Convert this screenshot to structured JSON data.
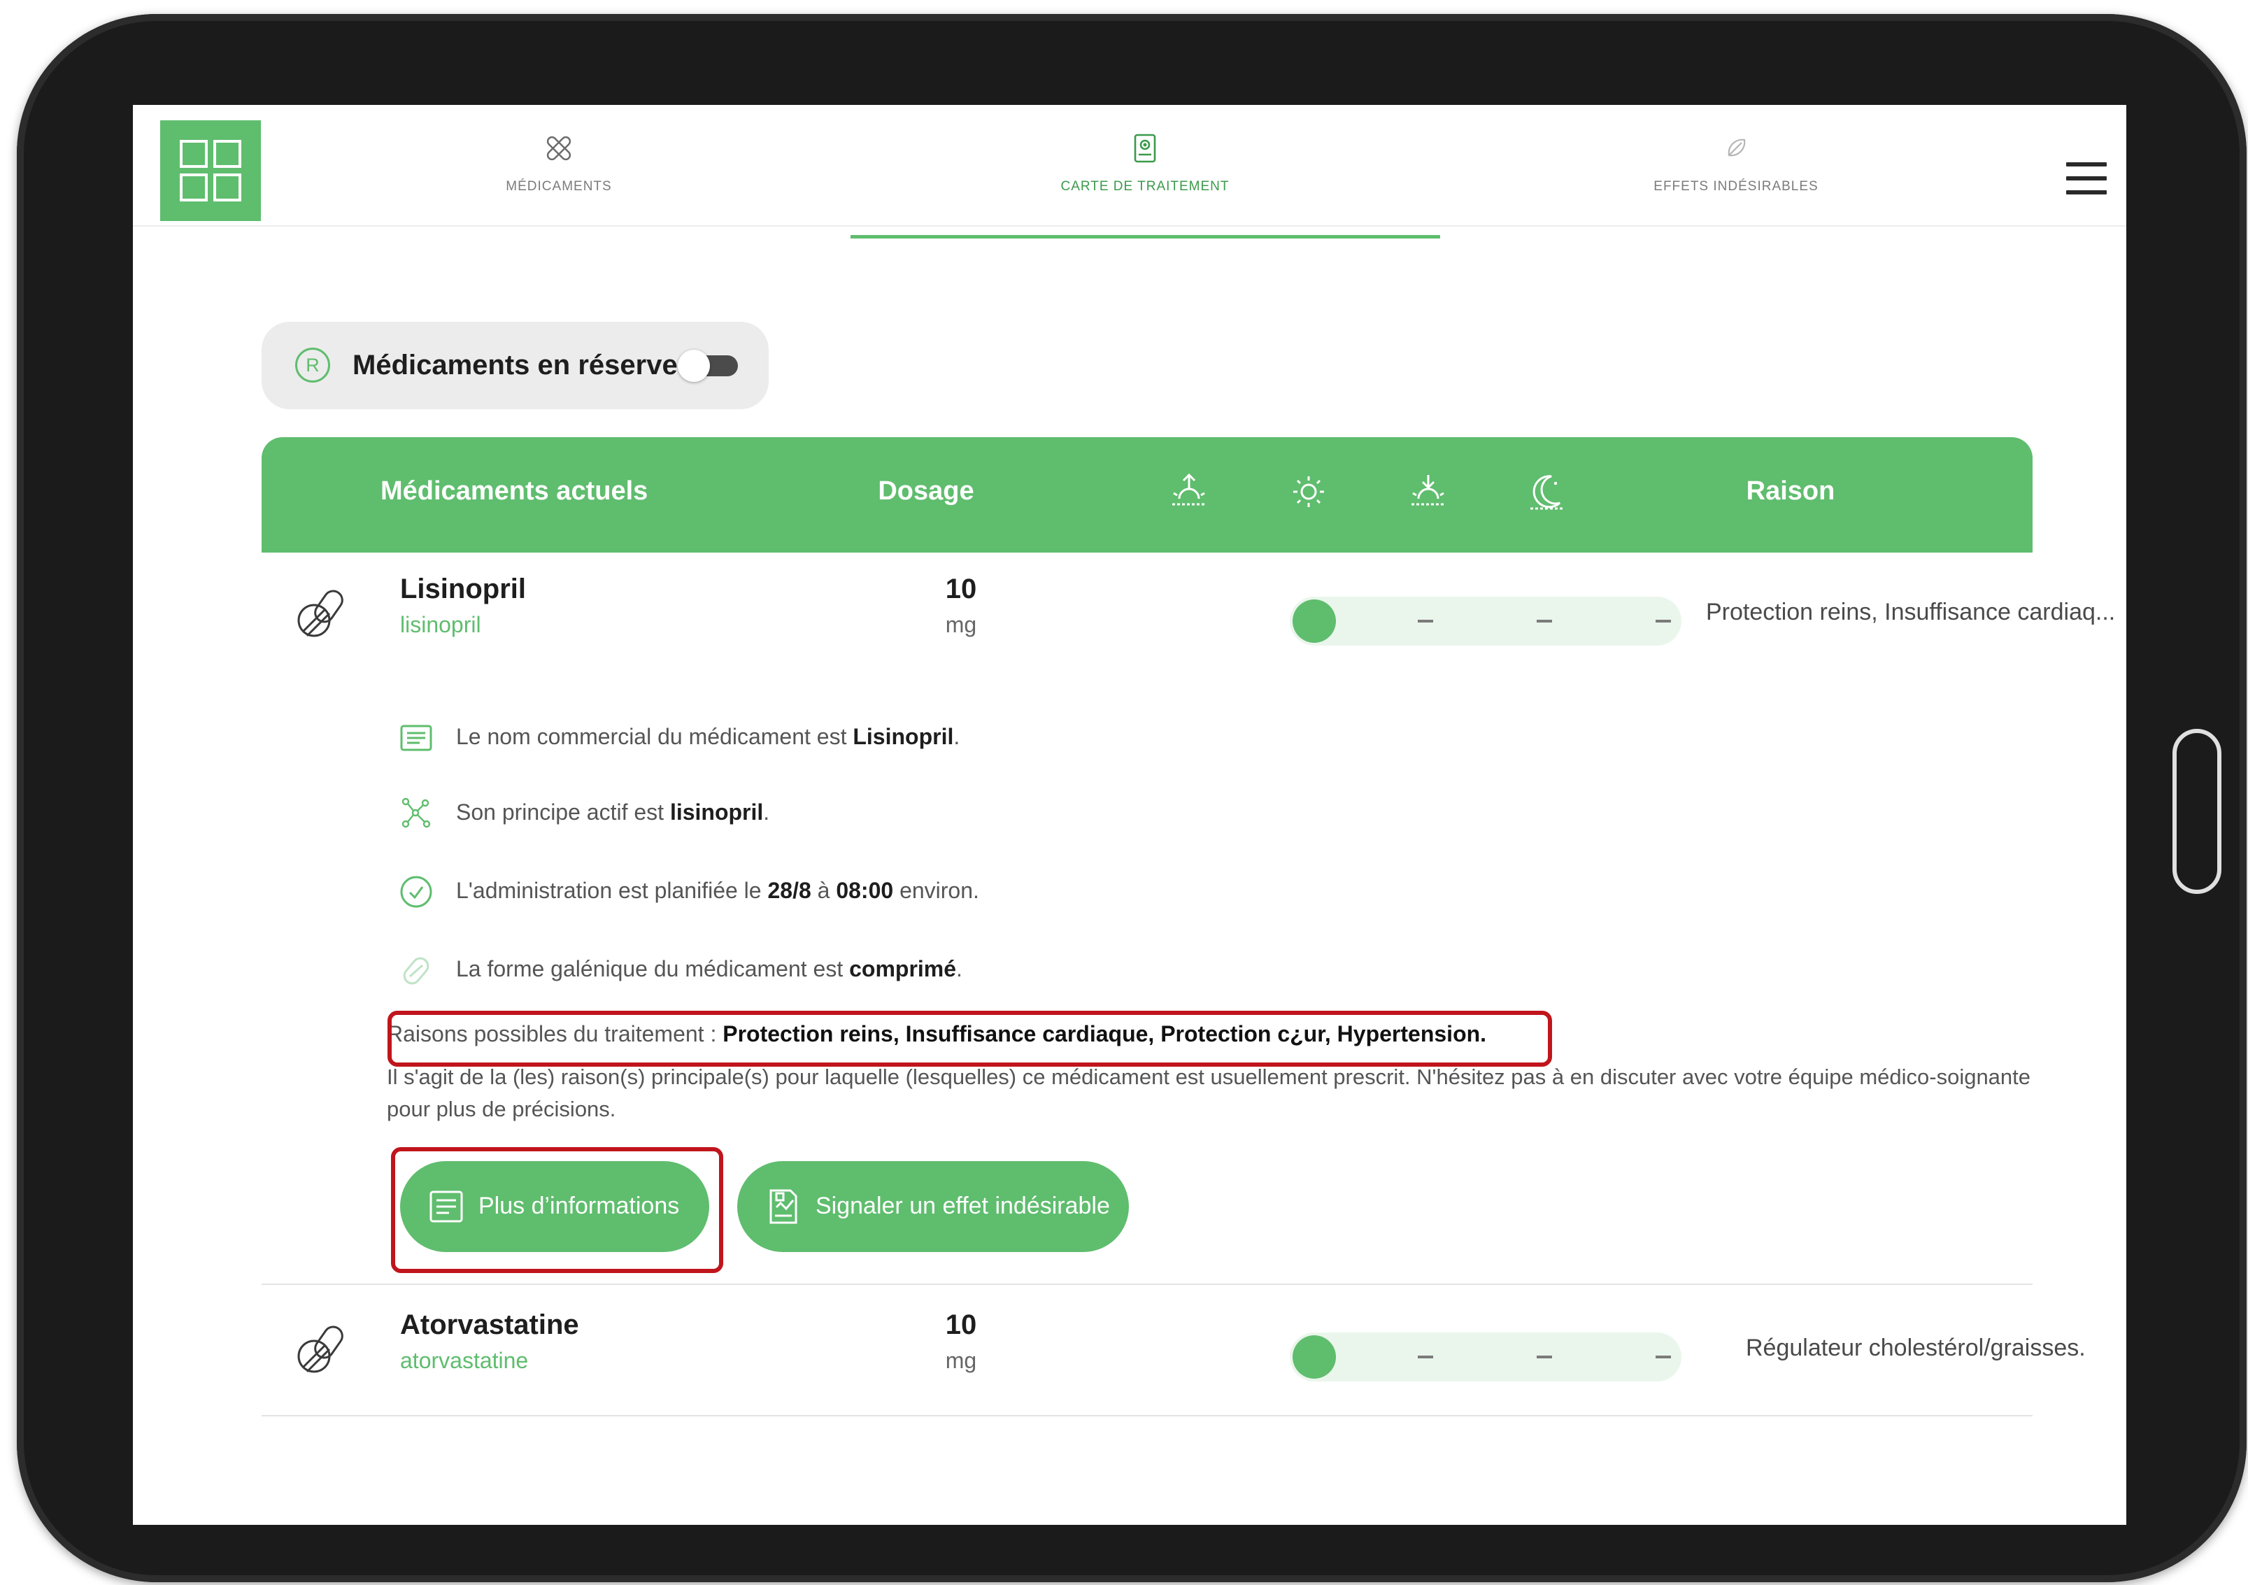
{
  "nav": {
    "tabs": [
      {
        "label": "MÉDICAMENTS",
        "icon": "bandage-icon"
      },
      {
        "label": "CARTE DE TRAITEMENT",
        "icon": "treatment-card-icon"
      },
      {
        "label": "EFFETS INDÉSIRABLES",
        "icon": "side-effect-icon"
      }
    ],
    "active_tab": "CARTE DE TRAITEMENT",
    "menu_icon": "hamburger-menu-icon",
    "app_icon": "app-grid-icon"
  },
  "reserve": {
    "badge": "R",
    "label": "Médicaments en réserve",
    "toggle_state": "off"
  },
  "table": {
    "headers": {
      "current": "Médicaments actuels",
      "dosage": "Dosage",
      "reason": "Raison"
    },
    "time_slots": [
      "sunrise-icon",
      "sun-icon",
      "sunset-icon",
      "moon-icon"
    ],
    "medications": [
      {
        "name": "Lisinopril",
        "generic": "lisinopril",
        "dose": "10",
        "unit": "mg",
        "schedule": [
          "done",
          "none",
          "none",
          "none"
        ],
        "reason": "Protection reins, Insuffisance cardiaq..."
      },
      {
        "name": "Atorvastatine",
        "generic": "atorvastatine",
        "dose": "10",
        "unit": "mg",
        "schedule": [
          "done",
          "none",
          "none",
          "none"
        ],
        "reason": "Régulateur cholestérol/graisses."
      }
    ]
  },
  "details": {
    "lines": [
      {
        "icon": "document-icon",
        "before": "Le nom commercial du médicament est ",
        "bold": "Lisinopril",
        "after": "."
      },
      {
        "icon": "molecule-icon",
        "before": "Son principe actif est ",
        "bold": "lisinopril",
        "after": "."
      },
      {
        "icon": "clock-icon",
        "before": "L'administration est planifiée le ",
        "bold": "28/8",
        "middle": " à ",
        "bold2": "08:00",
        "after": " environ."
      },
      {
        "icon": "pill-form-icon",
        "before": "La forme galénique du médicament est ",
        "bold": "comprimé",
        "after": "."
      }
    ],
    "reasons_prefix": "Raisons possibles du traitement : ",
    "reasons_value": "Protection reins, Insuffisance cardiaque, Protection c¿ur, Hypertension.",
    "disclaimer": "Il s'agit de la (les) raison(s) principale(s) pour laquelle (lesquelles) ce médicament est usuellement prescrit. N'hésitez pas à en discuter avec votre équipe médico-soignante pour plus de précisions.",
    "buttons": [
      {
        "label": "Plus d’informations",
        "icon": "info-document-icon"
      },
      {
        "label": "Signaler un effet indésirable",
        "icon": "report-form-icon"
      }
    ]
  },
  "theme": {
    "accent": "#5fbd6e",
    "accent_light": "#eaf6ec",
    "annotation_red": "#c0151c",
    "tablet_frame": "#1b1b1b"
  }
}
